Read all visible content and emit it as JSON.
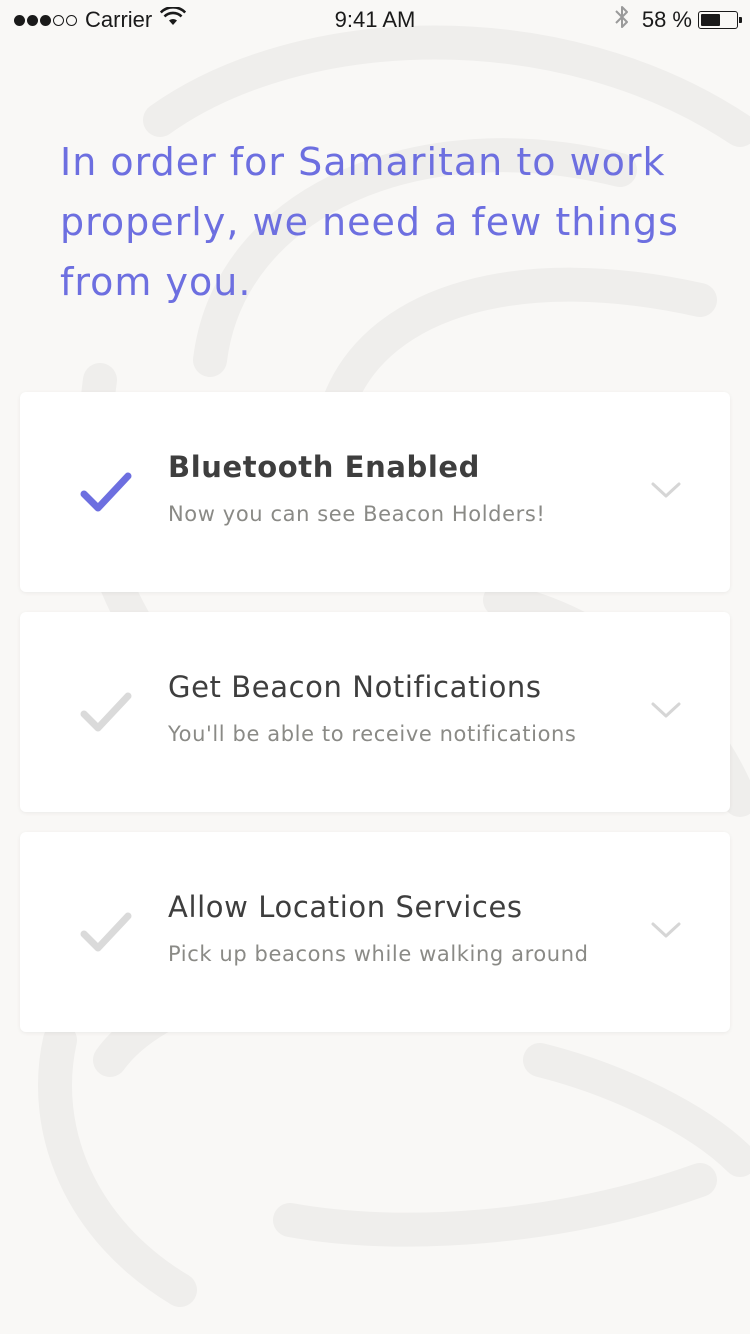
{
  "status_bar": {
    "signal_bars_filled": 3,
    "signal_bars_total": 5,
    "carrier": "Carrier",
    "time": "9:41 AM",
    "battery_percent": "58 %",
    "battery_level": 0.58
  },
  "headline": "In order for Samaritan to work properly, we need a few things from you.",
  "colors": {
    "accent": "#6d6fe0",
    "check_inactive": "#dadada",
    "background": "#f9f8f6"
  },
  "permissions": [
    {
      "title": "Bluetooth Enabled",
      "subtitle": "Now you can see Beacon Holders!",
      "enabled": true,
      "icon": "check-icon"
    },
    {
      "title": "Get Beacon Notifications",
      "subtitle": "You'll be able to receive notifications",
      "enabled": false,
      "icon": "check-icon"
    },
    {
      "title": "Allow Location Services",
      "subtitle": "Pick up beacons while walking around",
      "enabled": false,
      "icon": "check-icon"
    }
  ]
}
